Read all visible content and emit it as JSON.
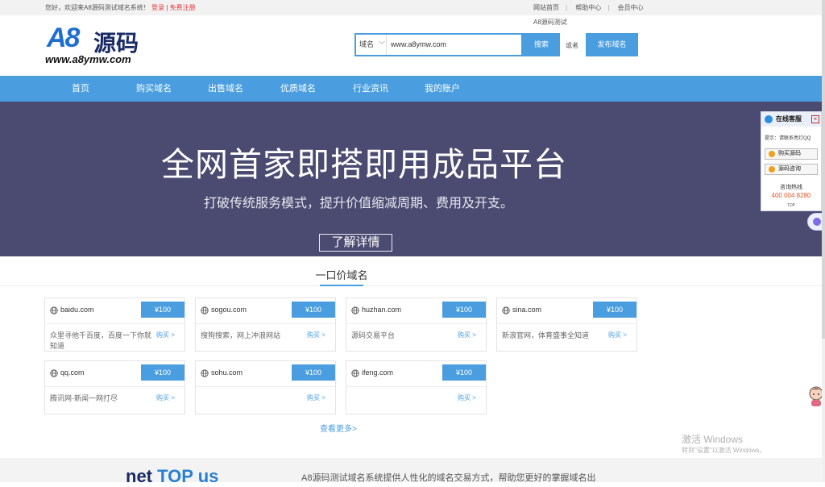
{
  "topbar": {
    "welcome": "您好，欢迎来A8源码测试域名系统！",
    "login": "登录",
    "separator": "|",
    "register": "免费注册",
    "links": [
      "网站首页",
      "帮助中心",
      "会员中心"
    ]
  },
  "logo": {
    "mark": "A8",
    "cn": "源码",
    "url": "www.a8ymw.com"
  },
  "search": {
    "hint": "A8源码测试",
    "type": "域名",
    "value": "www.a8ymw.com",
    "button": "搜索",
    "or": "或者",
    "publish": "发布域名"
  },
  "nav": [
    "首页",
    "购买域名",
    "出售域名",
    "优质域名",
    "行业资讯",
    "我的账户"
  ],
  "banner": {
    "headline": "全网首家即搭即用成品平台",
    "sub": "打破传统服务模式，提升价值缩减周期、费用及开支。",
    "more": "了解详情"
  },
  "section": {
    "title": "一口价域名",
    "see_more": "查看更多>"
  },
  "domains": [
    {
      "domain": "baidu.com",
      "price": "¥100",
      "desc": "众里寻他千百度，百度一下你就知道",
      "buy": "购买 >"
    },
    {
      "domain": "sogou.com",
      "price": "¥100",
      "desc": "搜狗搜索，网上冲浪网站",
      "buy": "购买 >"
    },
    {
      "domain": "huzhan.com",
      "price": "¥100",
      "desc": "源码交易平台",
      "buy": "购买 >"
    },
    {
      "domain": "sina.com",
      "price": "¥100",
      "desc": "新浪官网，体育盛事全知道",
      "buy": "购买 >"
    },
    {
      "domain": "qq.com",
      "price": "¥100",
      "desc": "腾讯网-新闻一网打尽",
      "buy": "购买 >"
    },
    {
      "domain": "sohu.com",
      "price": "¥100",
      "desc": "",
      "buy": "购买 >"
    },
    {
      "domain": "ifeng.com",
      "price": "¥100",
      "desc": "",
      "buy": "购买 >"
    }
  ],
  "footer": {
    "logo_a": "net",
    "logo_b": "TOP",
    "logo_c": "us",
    "desc": "A8源码测试域名系统提供人性化的域名交易方式，帮助您更好的掌握域名出"
  },
  "service": {
    "title": "在线客服",
    "close": "×",
    "hint": "提示：请联系亮灯QQ",
    "buttons": [
      "购买源码",
      "源码咨询"
    ],
    "hotline_label": "咨询热线",
    "phone": "400 004 8280",
    "top": "TOP"
  },
  "watermark": {
    "line1": "激活 Windows",
    "line2": "转到\"设置\"以激活 Windows。"
  },
  "colors": {
    "accent": "#4a9ee0",
    "banner": "#4b4b72",
    "price_red": "#e4393c"
  }
}
